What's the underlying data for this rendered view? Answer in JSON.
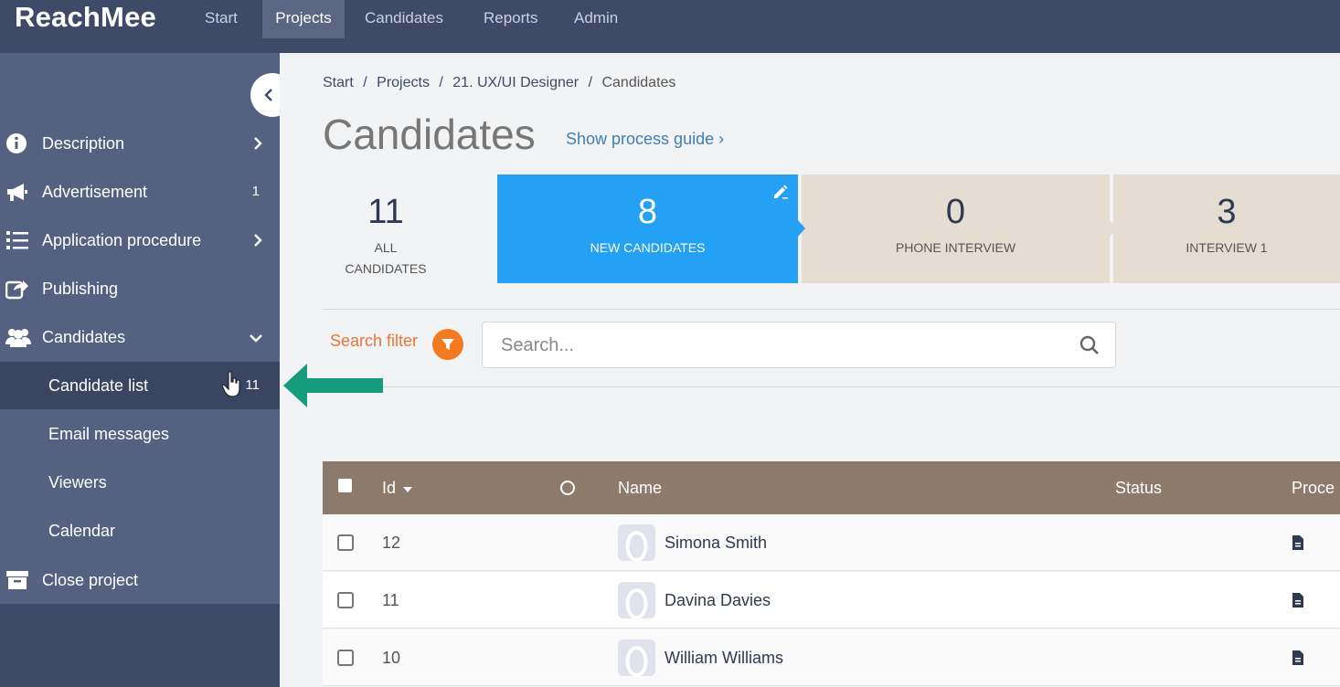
{
  "app": {
    "logo": "ReachMee"
  },
  "topnav": [
    "Start",
    "Projects",
    "Candidates",
    "Reports",
    "Admin"
  ],
  "sidebar": {
    "items": [
      {
        "label": "Description",
        "icon": "info-icon",
        "badge": "",
        "chevron": "right"
      },
      {
        "label": "Advertisement",
        "icon": "megaphone-icon",
        "badge": "1",
        "chevron": ""
      },
      {
        "label": "Application procedure",
        "icon": "list-icon",
        "badge": "",
        "chevron": "right"
      },
      {
        "label": "Publishing",
        "icon": "share-icon",
        "badge": "",
        "chevron": ""
      },
      {
        "label": "Candidates",
        "icon": "users-icon",
        "badge": "",
        "chevron": "down"
      }
    ],
    "subitems": [
      {
        "label": "Candidate list",
        "badge": "11",
        "selected": true
      },
      {
        "label": "Email messages",
        "badge": ""
      },
      {
        "label": "Viewers",
        "badge": ""
      },
      {
        "label": "Calendar",
        "badge": ""
      }
    ],
    "close": {
      "label": "Close project",
      "icon": "archive-icon"
    }
  },
  "breadcrumb": [
    "Start",
    "Projects",
    "21. UX/UI Designer",
    "Candidates"
  ],
  "page": {
    "title": "Candidates",
    "guide_link": "Show process guide ›"
  },
  "stages": [
    {
      "count": "11",
      "label_line1": "ALL",
      "label_line2": "CANDIDATES"
    },
    {
      "count": "8",
      "label_line1": "NEW CANDIDATES",
      "label_line2": ""
    },
    {
      "count": "0",
      "label_line1": "PHONE INTERVIEW",
      "label_line2": ""
    },
    {
      "count": "3",
      "label_line1": "INTERVIEW 1",
      "label_line2": ""
    }
  ],
  "search": {
    "filter_label": "Search filter",
    "placeholder": "Search..."
  },
  "table": {
    "columns": {
      "id": "Id",
      "name": "Name",
      "status": "Status",
      "process": "Proce"
    },
    "rows": [
      {
        "id": "12",
        "name": "Simona Smith"
      },
      {
        "id": "11",
        "name": "Davina Davies"
      },
      {
        "id": "10",
        "name": "William Williams"
      }
    ]
  },
  "colors": {
    "topbar": "#3f4a68",
    "accent_blue": "#24a1f5",
    "stage_beige": "#e5ddd1",
    "table_header": "#8c7a6b",
    "filter_orange": "#f47a22",
    "annotation_green": "#159c7c"
  }
}
